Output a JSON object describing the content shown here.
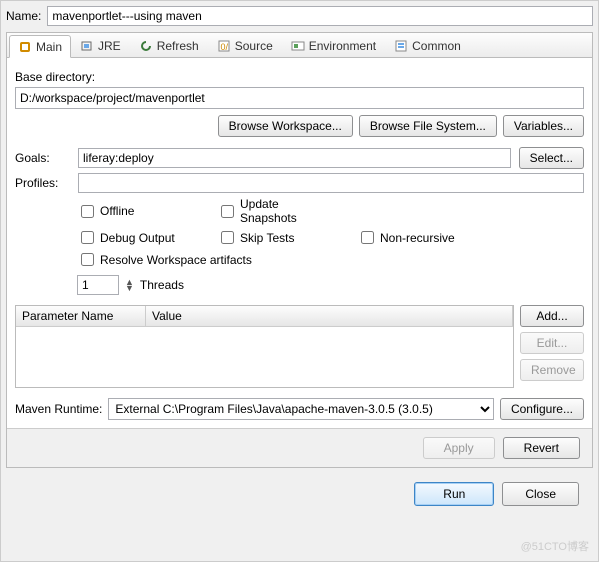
{
  "header": {
    "name_label": "Name:",
    "name_value": "mavenportlet---using maven"
  },
  "tabs": [
    {
      "label": "Main"
    },
    {
      "label": "JRE"
    },
    {
      "label": "Refresh"
    },
    {
      "label": "Source"
    },
    {
      "label": "Environment"
    },
    {
      "label": "Common"
    }
  ],
  "main": {
    "base_dir_label": "Base directory:",
    "base_dir_value": "D:/workspace/project/mavenportlet",
    "browse_ws": "Browse Workspace...",
    "browse_fs": "Browse File System...",
    "variables": "Variables...",
    "goals_label": "Goals:",
    "goals_value": "liferay:deploy",
    "select": "Select...",
    "profiles_label": "Profiles:",
    "profiles_value": "",
    "checks": {
      "offline": "Offline",
      "update_snapshots": "Update Snapshots",
      "debug_output": "Debug Output",
      "skip_tests": "Skip Tests",
      "non_recursive": "Non-recursive",
      "resolve_ws": "Resolve Workspace artifacts"
    },
    "threads_value": "1",
    "threads_label": "Threads",
    "table": {
      "col_param": "Parameter Name",
      "col_value": "Value"
    },
    "table_btns": {
      "add": "Add...",
      "edit": "Edit...",
      "remove": "Remove"
    },
    "runtime_label": "Maven Runtime:",
    "runtime_value": "External C:\\Program Files\\Java\\apache-maven-3.0.5 (3.0.5)",
    "configure": "Configure..."
  },
  "footer": {
    "apply": "Apply",
    "revert": "Revert",
    "run": "Run",
    "close": "Close"
  },
  "watermark": "@51CTO博客"
}
